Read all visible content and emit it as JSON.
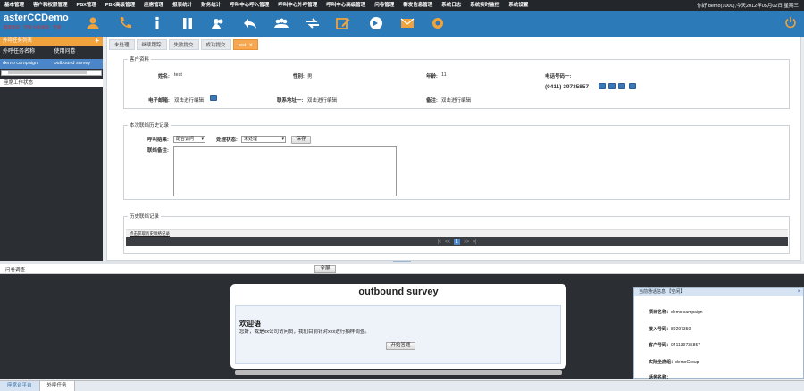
{
  "topmenu": {
    "items": [
      "基本管理",
      "客户和权限管理",
      "PBX管理",
      "PBX高级管理",
      "座席管理",
      "报表统计",
      "财务统计",
      "呼叫中心呼入管理",
      "呼叫中心外呼管理",
      "呼叫中心高级管理",
      "问卷管理",
      "群发信息管理",
      "系统日志",
      "系统实时监控",
      "系统设置"
    ],
    "user_info": "你好 demo(1000),今天2012年05月02日 星期三"
  },
  "toolbar": {
    "brand": "asterCCDemo",
    "subtitle": "座席状态：空闲 分机状态：空闲",
    "icons": [
      "agent-icon",
      "phone-icon",
      "info-icon",
      "pause-icon",
      "user-icon",
      "back-icon",
      "group-icon",
      "transfer-icon",
      "edit-icon",
      "dial-icon",
      "mail-icon",
      "settings-icon"
    ],
    "colors": {
      "bar": "#2d7ab9",
      "accent": "#f0a23c"
    }
  },
  "sidebar": {
    "top_label": "外呼任务列表",
    "col_task": "外呼任务名称",
    "col_survey": "使用问卷",
    "row_task": "demo campaign",
    "row_survey": "outbound survey",
    "work_status": "座席工作状态"
  },
  "tabs": [
    "未处理",
    "继续跟踪",
    "失败提交",
    "成功提交",
    "test"
  ],
  "customer_fieldset": {
    "legend": "客户资料",
    "name_label": "姓名:",
    "name_value": "test",
    "gender_label": "性别:",
    "gender_value": "男",
    "age_label": "年龄:",
    "age_value": "11",
    "phone_label": "电话号码一:",
    "phone_value": "(0411) 39735857",
    "email_label": "电子邮箱:",
    "email_value": "双击进行编辑",
    "address_label": "联系地址一:",
    "address_value": "双击进行编辑",
    "remark_label": "备注:",
    "remark_value": "双击进行编辑"
  },
  "record_fieldset": {
    "legend": "本次联络历史记录",
    "result_label": "呼叫结果:",
    "result_value": "配合访问",
    "state_label": "处理状态:",
    "state_value": "未处理",
    "save_button": "保存",
    "new_remark_label": "联络备注:"
  },
  "history_fieldset": {
    "legend": "历史联络记录",
    "link": "点击获取历史联络记录",
    "pager": {
      "first": "|<",
      "prev": "<<",
      "page": "1",
      "next": ">>",
      "last": ">|"
    }
  },
  "questionnaire": {
    "bar_title": "问卷调查",
    "fullscreen_button": "全屏",
    "survey_title": "outbound survey",
    "greeting": "欢迎语",
    "greeting_text": "您好，我是xx公司访问员，我们目前针对xxx进行抽样调查。",
    "start_button": "开始答题"
  },
  "customer_card": {
    "header": "当前通话信息 【空闲】",
    "project_label": "项目名称：",
    "project_value": "demo campaign",
    "inbound_label": "接入号码：",
    "inbound_value": "89297350",
    "phone_label": "客户号码：",
    "phone_value": "041139735857",
    "group_label": "实际坐席组：",
    "group_value": "demoGroup",
    "agent_label": "话务名称："
  },
  "status_tabs": [
    "座席台平台",
    "外呼任务"
  ]
}
